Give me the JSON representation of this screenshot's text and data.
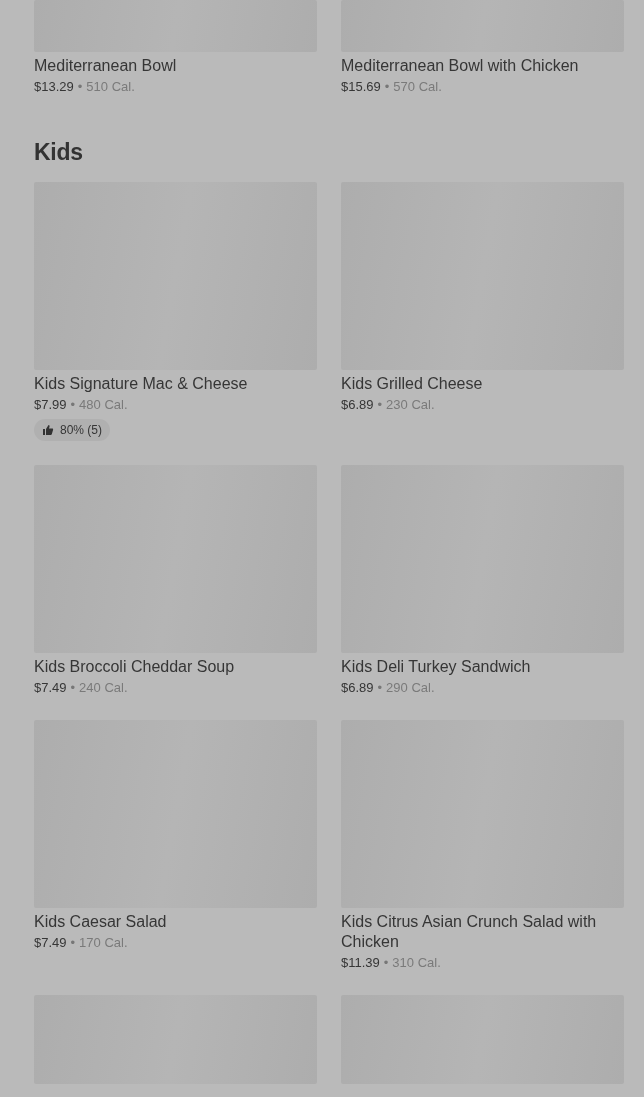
{
  "sections": [
    {
      "items": [
        {
          "kind": "dish",
          "name": "Mediterranean Bowl",
          "price": "$13.29",
          "separator": "•",
          "calories": "510 Cal."
        },
        {
          "kind": "dish",
          "name": "Mediterranean Bowl with Chicken",
          "price": "$15.69",
          "separator": "•",
          "calories": "570 Cal."
        }
      ]
    },
    {
      "title": "Kids",
      "items": [
        {
          "kind": "dish",
          "name": "Kids Signature Mac & Cheese",
          "price": "$7.99",
          "separator": "•",
          "calories": "480 Cal.",
          "rating": "80% (5)"
        },
        {
          "kind": "dish",
          "name": "Kids Grilled Cheese",
          "price": "$6.89",
          "separator": "•",
          "calories": "230 Cal."
        },
        {
          "kind": "dish",
          "name": "Kids Broccoli Cheddar Soup",
          "price": "$7.49",
          "separator": "•",
          "calories": "240 Cal."
        },
        {
          "kind": "dish",
          "name": "Kids Deli Turkey Sandwich",
          "price": "$6.89",
          "separator": "•",
          "calories": "290 Cal."
        },
        {
          "kind": "dish",
          "name": "Kids Caesar Salad",
          "price": "$7.49",
          "separator": "•",
          "calories": "170 Cal."
        },
        {
          "kind": "dish",
          "name": "Kids Citrus Asian Crunch Salad with Chicken",
          "price": "$11.39",
          "separator": "•",
          "calories": "310 Cal."
        },
        {
          "kind": "picture"
        },
        {
          "kind": "picture"
        }
      ]
    }
  ]
}
